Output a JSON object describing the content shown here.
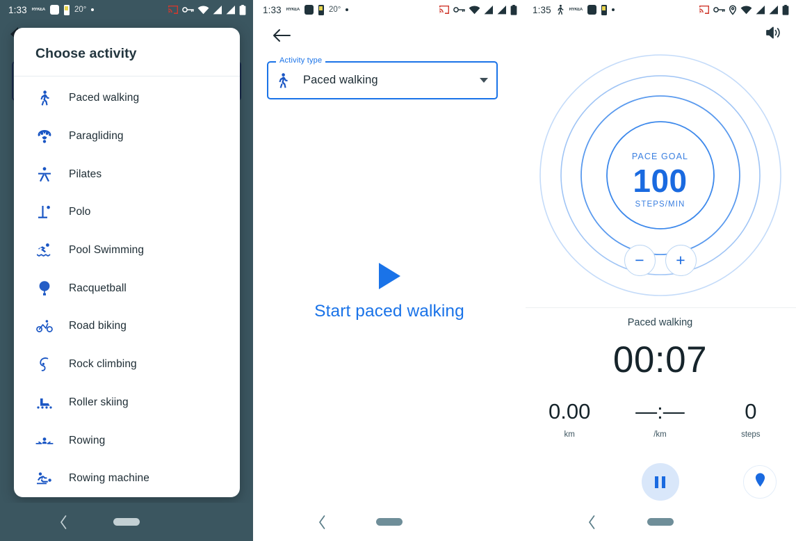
{
  "panel1": {
    "statusbar": {
      "time": "1:33",
      "carrier": "RYKEA",
      "temperature": "20°",
      "icons": [
        "cast-icon",
        "vpn-key-icon",
        "wifi-icon",
        "signal-icon",
        "signal-icon",
        "battery-icon"
      ]
    },
    "dialog": {
      "title": "Choose activity",
      "items": [
        {
          "label": "Paced walking",
          "icon": "walking-icon"
        },
        {
          "label": "Paragliding",
          "icon": "paragliding-icon"
        },
        {
          "label": "Pilates",
          "icon": "pilates-icon"
        },
        {
          "label": "Polo",
          "icon": "polo-icon"
        },
        {
          "label": "Pool Swimming",
          "icon": "swimming-icon"
        },
        {
          "label": "Racquetball",
          "icon": "racquet-icon"
        },
        {
          "label": "Road biking",
          "icon": "bicycle-icon"
        },
        {
          "label": "Rock climbing",
          "icon": "climbing-icon"
        },
        {
          "label": "Roller skiing",
          "icon": "roller-ski-icon"
        },
        {
          "label": "Rowing",
          "icon": "rowing-icon"
        },
        {
          "label": "Rowing machine",
          "icon": "rowing-machine-icon"
        }
      ]
    },
    "navbar": {
      "back": "back-chevron-icon",
      "home": "home-pill"
    }
  },
  "panel2": {
    "statusbar": {
      "time": "1:33",
      "carrier": "RYKEA",
      "temperature": "20°"
    },
    "back_icon": "back-arrow-icon",
    "field": {
      "legend": "Activity type",
      "value": "Paced walking",
      "icon": "walking-icon",
      "dropdown": "chevron-down-icon"
    },
    "start": {
      "icon": "play-icon",
      "label": "Start paced walking"
    },
    "navbar": {
      "back": "back-chevron-icon",
      "home": "home-pill"
    }
  },
  "panel3": {
    "statusbar": {
      "time": "1:35",
      "carrier": "RYKEA",
      "icons": [
        "walking-icon",
        "cast-icon",
        "vpn-key-icon",
        "location-icon",
        "wifi-icon",
        "signal-icon",
        "signal-icon",
        "battery-icon"
      ]
    },
    "volume_icon": "volume-up-icon",
    "pace": {
      "title": "PACE GOAL",
      "value": "100",
      "unit": "STEPS/MIN",
      "decrease": "−",
      "increase": "+"
    },
    "session": {
      "activity": "Paced walking",
      "timer": "00:07",
      "stats": [
        {
          "value": "0.00",
          "unit": "km"
        },
        {
          "value": "—:—",
          "unit": "/km"
        },
        {
          "value": "0",
          "unit": "steps"
        }
      ]
    },
    "controls": {
      "pause": "pause-icon",
      "location": "location-pin-icon"
    },
    "navbar": {
      "back": "back-chevron-icon",
      "home": "home-pill"
    }
  },
  "colors": {
    "accent": "#1a73e8",
    "icon_blue": "#1a56c4",
    "scrim": "#3b5660",
    "text_dark": "#1c2b33"
  }
}
